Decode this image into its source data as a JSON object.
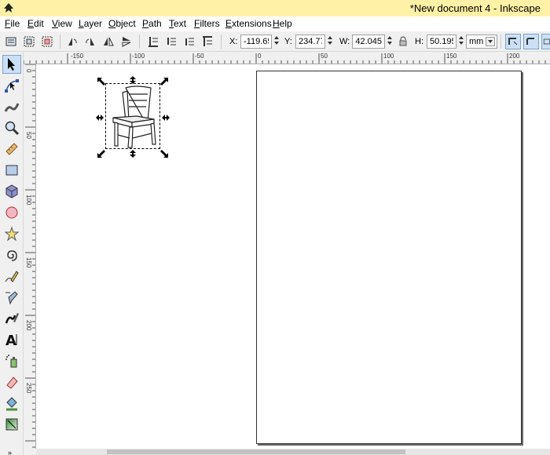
{
  "window": {
    "title": "*New document 4 - Inkscape",
    "titlebar_color": "#fff2a6"
  },
  "menu": [
    "File",
    "Edit",
    "View",
    "Layer",
    "Object",
    "Path",
    "Text",
    "Filters",
    "Extensions",
    "Help"
  ],
  "toolbar": {
    "x_label": "X:",
    "x_value": "-119.65",
    "y_label": "Y:",
    "y_value": "234.778",
    "w_label": "W:",
    "w_value": "42.045",
    "h_label": "H:",
    "h_value": "50.195",
    "unit": "mm"
  },
  "ruler_h_labels": [
    "-150",
    "-100",
    "-50",
    "0",
    "50",
    "100",
    "150",
    "200"
  ],
  "ruler_v_labels": [
    "0",
    "50",
    "100",
    "150",
    "200",
    "250"
  ],
  "tools": [
    "selector-tool",
    "node-tool",
    "tweak-tool",
    "zoom-tool",
    "measure-tool",
    "rectangle-tool",
    "3d-box-tool",
    "ellipse-tool",
    "star-tool",
    "spiral-tool",
    "pencil-tool",
    "pen-tool",
    "calligraphy-tool",
    "text-tool",
    "spray-tool",
    "eraser-tool",
    "paint-bucket-tool",
    "gradient-tool"
  ],
  "toolbox_more": "»",
  "colors": {
    "accent": "#cce0f5",
    "accent_border": "#7da2ce"
  }
}
